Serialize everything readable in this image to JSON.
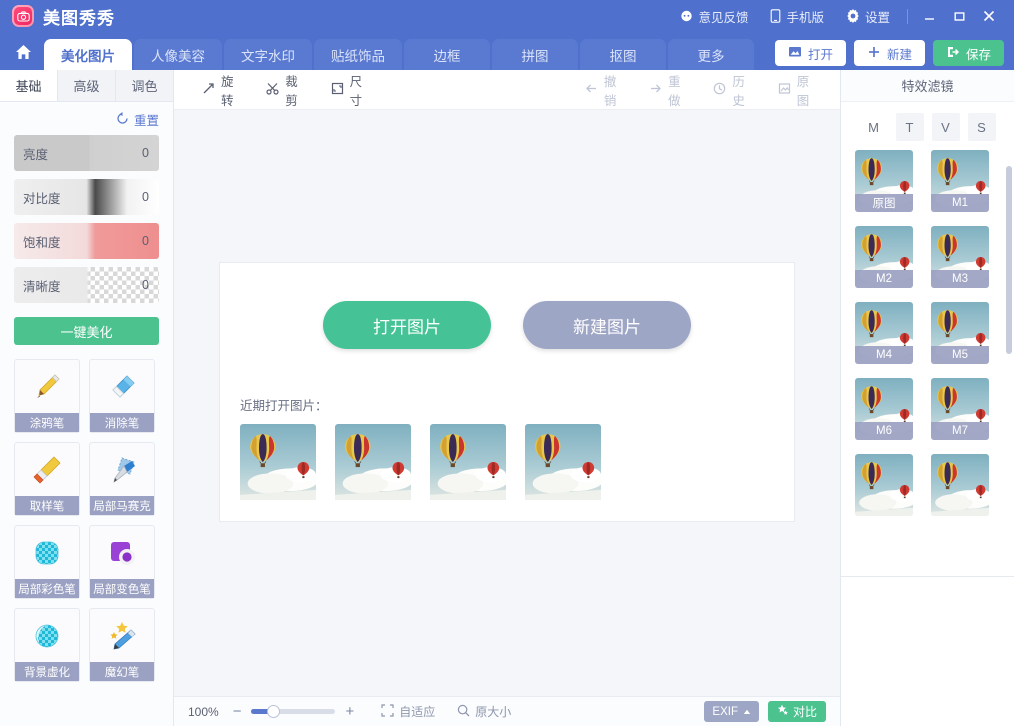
{
  "app": {
    "title": "美图秀秀",
    "logo_icon": "camera-logo-icon"
  },
  "titlebar": {
    "feedback": "意见反馈",
    "feedback_icon": "chat-icon",
    "mobile": "手机版",
    "mobile_icon": "phone-icon",
    "settings": "设置",
    "settings_icon": "gear-icon",
    "minimize_icon": "minimize-icon",
    "maximize_icon": "maximize-icon",
    "close_icon": "close-icon"
  },
  "tabs": {
    "home_icon": "home-icon",
    "items": [
      {
        "label": "美化图片",
        "active": true
      },
      {
        "label": "人像美容",
        "active": false
      },
      {
        "label": "文字水印",
        "active": false
      },
      {
        "label": "贴纸饰品",
        "active": false
      },
      {
        "label": "边框",
        "active": false
      },
      {
        "label": "拼图",
        "active": false
      },
      {
        "label": "抠图",
        "active": false
      },
      {
        "label": "更多",
        "active": false
      }
    ],
    "actions": [
      {
        "label": "打开",
        "icon": "image-open-icon",
        "style": "white"
      },
      {
        "label": "新建",
        "icon": "plus-icon",
        "style": "white"
      },
      {
        "label": "保存",
        "icon": "save-export-icon",
        "style": "green"
      }
    ]
  },
  "sidebar": {
    "tabs": [
      {
        "label": "基础",
        "active": true
      },
      {
        "label": "高级",
        "active": false
      },
      {
        "label": "调色",
        "active": false
      }
    ],
    "reset": {
      "label": "重置",
      "icon": "reset-icon"
    },
    "sliders": [
      {
        "label": "亮度",
        "value": "0"
      },
      {
        "label": "对比度",
        "value": "0"
      },
      {
        "label": "饱和度",
        "value": "0"
      },
      {
        "label": "清晰度",
        "value": "0"
      }
    ],
    "beautify_button": "一键美化",
    "tools": [
      {
        "label": "涂鸦笔",
        "icon": "pencil-brush-icon"
      },
      {
        "label": "消除笔",
        "icon": "eraser-icon"
      },
      {
        "label": "取样笔",
        "icon": "paint-brush-icon"
      },
      {
        "label": "局部马赛克",
        "icon": "mosaic-pen-icon"
      },
      {
        "label": "局部彩色笔",
        "icon": "color-pen-icon"
      },
      {
        "label": "局部变色笔",
        "icon": "hue-pen-icon"
      },
      {
        "label": "背景虚化",
        "icon": "blur-icon"
      },
      {
        "label": "魔幻笔",
        "icon": "magic-pen-icon"
      }
    ]
  },
  "toolbar": {
    "left": [
      {
        "label": "旋转",
        "icon": "rotate-icon",
        "enabled": true
      },
      {
        "label": "裁剪",
        "icon": "crop-scissors-icon",
        "enabled": true
      },
      {
        "label": "尺寸",
        "icon": "resize-icon",
        "enabled": true
      }
    ],
    "right": [
      {
        "label": "撤销",
        "icon": "undo-arrow-icon",
        "enabled": false
      },
      {
        "label": "重做",
        "icon": "redo-arrow-icon",
        "enabled": false
      },
      {
        "label": "历史",
        "icon": "clock-history-icon",
        "enabled": false
      },
      {
        "label": "原图",
        "icon": "original-image-icon",
        "enabled": false
      }
    ]
  },
  "welcome": {
    "open_button": "打开图片",
    "new_button": "新建图片",
    "recent_label": "近期打开图片：",
    "recent_count": 4
  },
  "statusbar": {
    "zoom": "100%",
    "minus": "−",
    "plus": "+",
    "fit": "自适应",
    "fit_icon": "fit-screen-icon",
    "original_size": "原大小",
    "original_size_icon": "magnifier-icon",
    "exif": "EXIF",
    "exif_caret_icon": "caret-up-icon",
    "compare": "对比",
    "compare_icon": "star-compare-icon"
  },
  "filters": {
    "title": "特效滤镜",
    "tabs": [
      {
        "label": "M",
        "active": true
      },
      {
        "label": "T",
        "active": false
      },
      {
        "label": "V",
        "active": false
      },
      {
        "label": "S",
        "active": false
      }
    ],
    "items": [
      {
        "label": "原图"
      },
      {
        "label": "M1"
      },
      {
        "label": "M2"
      },
      {
        "label": "M3"
      },
      {
        "label": "M4"
      },
      {
        "label": "M5"
      },
      {
        "label": "M6"
      },
      {
        "label": "M7"
      },
      {
        "label": ""
      },
      {
        "label": ""
      }
    ]
  },
  "colors": {
    "header_blue": "#4f70cc",
    "accent_green": "#4cc38f",
    "muted_purple": "#9ea6c6",
    "label_bar": "#9ba1c2"
  }
}
